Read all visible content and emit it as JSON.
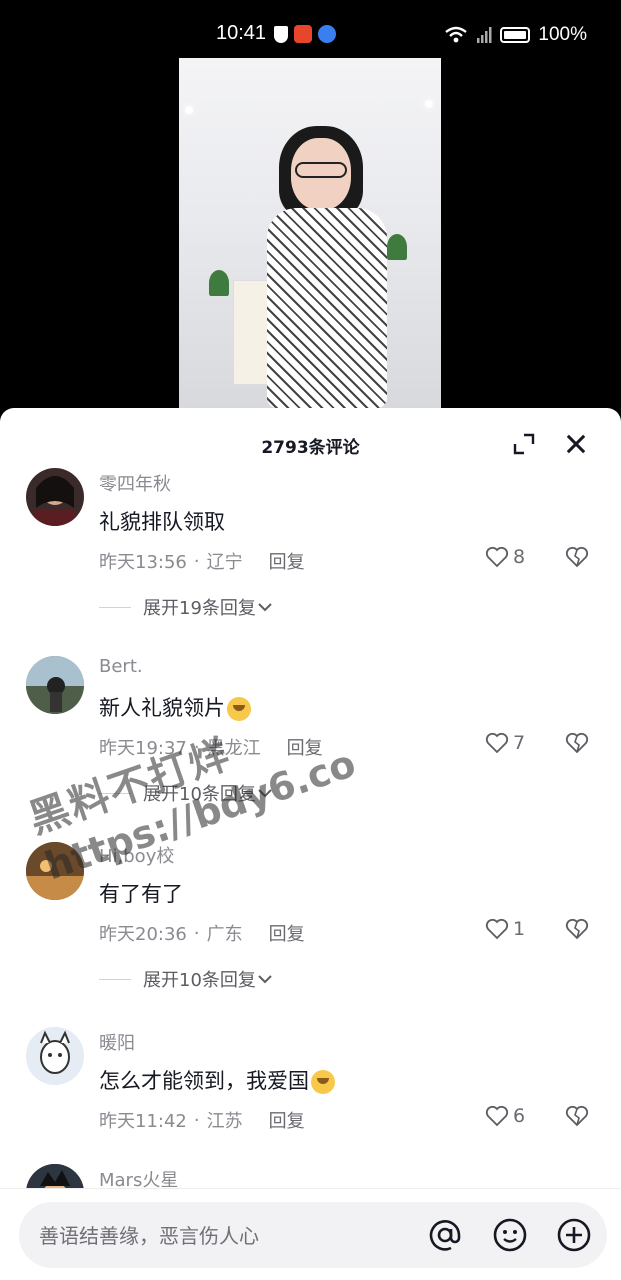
{
  "status_bar": {
    "time": "10:41",
    "battery": "100%"
  },
  "panel": {
    "title": "2793条评论"
  },
  "comments": [
    {
      "user": "零四年秋",
      "text": "礼貌排队领取",
      "date": "昨天13:56",
      "location": "辽宁",
      "reply_label": "回复",
      "likes": "8",
      "expand_label": "展开19条回复",
      "avatar_color": "#3b2a2a"
    },
    {
      "user": "Bert.",
      "text": "新人礼貌领片",
      "date": "昨天19:37",
      "location": "黑龙江",
      "reply_label": "回复",
      "likes": "7",
      "expand_label": "展开10条回复",
      "avatar_color": "#6b7a6a"
    },
    {
      "user": "Hi,boy校",
      "text": "有了有了",
      "date": "昨天20:36",
      "location": "广东",
      "reply_label": "回复",
      "likes": "1",
      "expand_label": "展开10条回复",
      "avatar_color": "#7a5a3a"
    },
    {
      "user": "暖阳",
      "text": "怎么才能领到，我爱国",
      "date": "昨天11:42",
      "location": "江苏",
      "reply_label": "回复",
      "likes": "6",
      "avatar_color": "#dfe6ee"
    },
    {
      "user": "Mars火星",
      "avatar_color": "#2d3540"
    }
  ],
  "input": {
    "placeholder": "善语结善缘，恶言伤人心"
  },
  "watermark": {
    "line1": "黑料不打烊",
    "line2": "https://bdy6.co"
  },
  "colors": {
    "text_primary": "#161823",
    "text_secondary": "#8a8b91",
    "panel_bg": "#ffffff"
  }
}
